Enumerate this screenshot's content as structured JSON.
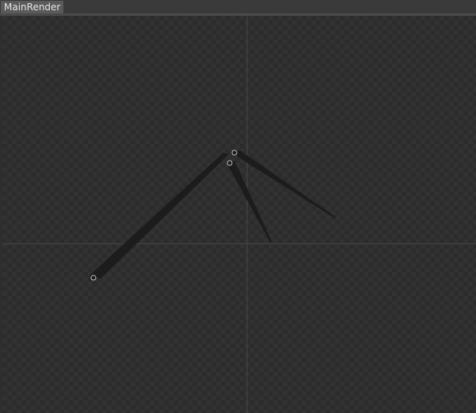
{
  "window": {
    "tab_label": "MainRender"
  },
  "viewport": {
    "background": "checkerboard",
    "axis_color": "#4a4a4a",
    "hand_color": "#1c1c1c",
    "pivot_color": "#bdbdbd",
    "objects": [
      {
        "name": "long-hand"
      },
      {
        "name": "middle-hand"
      },
      {
        "name": "short-hand"
      }
    ]
  }
}
